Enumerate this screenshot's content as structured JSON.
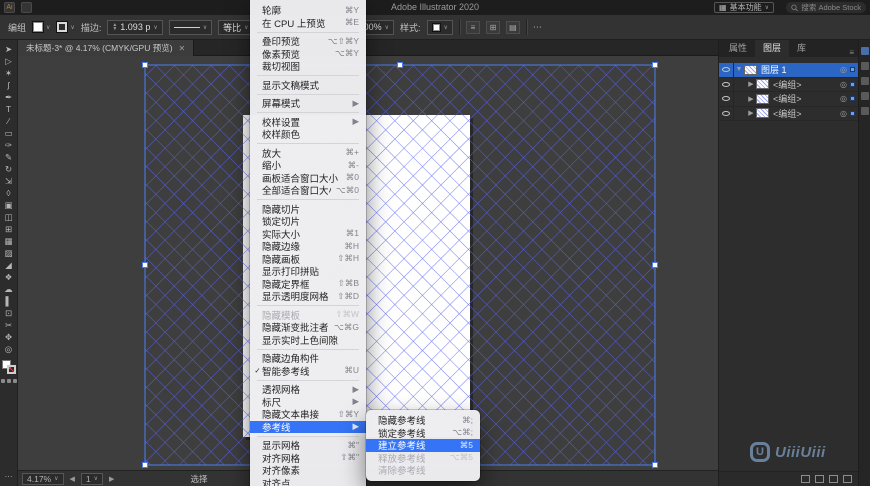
{
  "colors": {
    "guide_blue": "#5a64f0",
    "selection_blue": "#4a7df0",
    "menu_highlight": "#3574f6",
    "layer_selected_blue": "#2b66c4",
    "watermark_blue": "rgba(148,190,235,.58)"
  },
  "titlebar": {
    "title": "Adobe Illustrator 2020",
    "workspace_button": "基本功能",
    "search_placeholder": "搜索 Adobe Stock"
  },
  "control_bar": {
    "context_label": "编组",
    "stroke_label": "描边:",
    "stroke_weight": "1.093 p",
    "profile": "等比",
    "opacity": "100%",
    "style_label": "样式:",
    "more": "⋯"
  },
  "document": {
    "tab_title": "未标题-3* @ 4.17% (CMYK/GPU 预览)",
    "tab_close": "✕"
  },
  "toolbar": {
    "tools": [
      {
        "name": "selection-tool",
        "glyph": "➤"
      },
      {
        "name": "direct-selection-tool",
        "glyph": "▷"
      },
      {
        "name": "magic-wand-tool",
        "glyph": "✶"
      },
      {
        "name": "lasso-tool",
        "glyph": "ʃ"
      },
      {
        "name": "pen-tool",
        "glyph": "✒"
      },
      {
        "name": "type-tool",
        "glyph": "T"
      },
      {
        "name": "line-segment-tool",
        "glyph": "∕"
      },
      {
        "name": "rectangle-tool",
        "glyph": "▭"
      },
      {
        "name": "paintbrush-tool",
        "glyph": "✑"
      },
      {
        "name": "pencil-tool",
        "glyph": "✎"
      },
      {
        "name": "rotate-tool",
        "glyph": "↻"
      },
      {
        "name": "scale-tool",
        "glyph": "⇲"
      },
      {
        "name": "width-tool",
        "glyph": "◊"
      },
      {
        "name": "free-transform-tool",
        "glyph": "▣"
      },
      {
        "name": "shape-builder-tool",
        "glyph": "◫"
      },
      {
        "name": "perspective-grid-tool",
        "glyph": "⊞"
      },
      {
        "name": "mesh-tool",
        "glyph": "▦"
      },
      {
        "name": "gradient-tool",
        "glyph": "▨"
      },
      {
        "name": "eyedropper-tool",
        "glyph": "◢"
      },
      {
        "name": "blend-tool",
        "glyph": "❖"
      },
      {
        "name": "symbol-sprayer-tool",
        "glyph": "☁"
      },
      {
        "name": "column-graph-tool",
        "glyph": "▌"
      },
      {
        "name": "artboard-tool",
        "glyph": "⊡"
      },
      {
        "name": "slice-tool",
        "glyph": "✂"
      },
      {
        "name": "hand-tool",
        "glyph": "✥"
      },
      {
        "name": "zoom-tool",
        "glyph": "◎"
      }
    ]
  },
  "view_menu": {
    "items": [
      {
        "label": "轮廓",
        "shortcut": "⌘Y"
      },
      {
        "label": "在 CPU 上预览",
        "shortcut": "⌘E"
      },
      {
        "type": "sep"
      },
      {
        "label": "叠印预览",
        "shortcut": "⌥⇧⌘Y"
      },
      {
        "label": "像素预览",
        "shortcut": "⌥⌘Y"
      },
      {
        "label": "裁切视图"
      },
      {
        "type": "sep"
      },
      {
        "label": "显示文稿模式"
      },
      {
        "type": "sep"
      },
      {
        "label": "屏幕模式",
        "submenu": true
      },
      {
        "type": "sep"
      },
      {
        "label": "校样设置",
        "submenu": true
      },
      {
        "label": "校样颜色"
      },
      {
        "type": "sep"
      },
      {
        "label": "放大",
        "shortcut": "⌘+"
      },
      {
        "label": "缩小",
        "shortcut": "⌘-"
      },
      {
        "label": "画板适合窗口大小",
        "shortcut": "⌘0"
      },
      {
        "label": "全部适合窗口大小",
        "shortcut": "⌥⌘0"
      },
      {
        "type": "sep"
      },
      {
        "label": "隐藏切片"
      },
      {
        "label": "锁定切片"
      },
      {
        "label": "实际大小",
        "shortcut": "⌘1"
      },
      {
        "label": "隐藏边缘",
        "shortcut": "⌘H"
      },
      {
        "label": "隐藏画板",
        "shortcut": "⇧⌘H"
      },
      {
        "label": "显示打印拼贴"
      },
      {
        "label": "隐藏定界框",
        "shortcut": "⇧⌘B"
      },
      {
        "label": "显示透明度网格",
        "shortcut": "⇧⌘D"
      },
      {
        "type": "sep"
      },
      {
        "label": "隐藏模板",
        "shortcut": "⇧⌘W",
        "disabled": true
      },
      {
        "label": "隐藏渐变批注者",
        "shortcut": "⌥⌘G"
      },
      {
        "label": "显示实时上色间隙"
      },
      {
        "type": "sep"
      },
      {
        "label": "隐藏边角构件"
      },
      {
        "label": "智能参考线",
        "shortcut": "⌘U",
        "checked": true
      },
      {
        "type": "sep"
      },
      {
        "label": "透视网格",
        "submenu": true
      },
      {
        "label": "标尺",
        "submenu": true
      },
      {
        "label": "隐藏文本串接",
        "shortcut": "⇧⌘Y"
      },
      {
        "label": "参考线",
        "submenu": true,
        "highlighted": true
      },
      {
        "type": "sep"
      },
      {
        "label": "显示网格",
        "shortcut": "⌘\""
      },
      {
        "label": "对齐网格",
        "shortcut": "⇧⌘\""
      },
      {
        "label": "对齐像素"
      },
      {
        "label": "对齐点"
      }
    ]
  },
  "guides_submenu": {
    "items": [
      {
        "label": "隐藏参考线",
        "shortcut": "⌘;"
      },
      {
        "label": "锁定参考线",
        "shortcut": "⌥⌘;"
      },
      {
        "label": "建立参考线",
        "shortcut": "⌘5",
        "highlighted": true
      },
      {
        "label": "释放参考线",
        "shortcut": "⌥⌘5",
        "disabled": true
      },
      {
        "label": "清除参考线",
        "disabled": true
      }
    ]
  },
  "layers_panel": {
    "tabs": [
      {
        "label": "属性"
      },
      {
        "label": "图层",
        "active": true
      },
      {
        "label": "库"
      }
    ],
    "rows": [
      {
        "name": "图层 1",
        "level": 0,
        "selected": true,
        "expanded": true
      },
      {
        "name": "<编组>",
        "level": 1
      },
      {
        "name": "<编组>",
        "level": 1
      },
      {
        "name": "<编组>",
        "level": 1
      }
    ],
    "footer_icons": [
      "make-clipping-mask-icon",
      "new-sublayer-icon",
      "new-layer-icon",
      "delete-layer-icon"
    ]
  },
  "icon_dock": {
    "icons": [
      "color-panel-icon",
      "swatches-panel-icon",
      "brushes-panel-icon",
      "symbols-panel-icon",
      "libraries-panel-icon"
    ]
  },
  "status_bar": {
    "zoom": "4.17%",
    "artboard_number": "1",
    "tool_name": "选择"
  },
  "watermark": {
    "logo": "U",
    "text": "UiiiUiii"
  }
}
